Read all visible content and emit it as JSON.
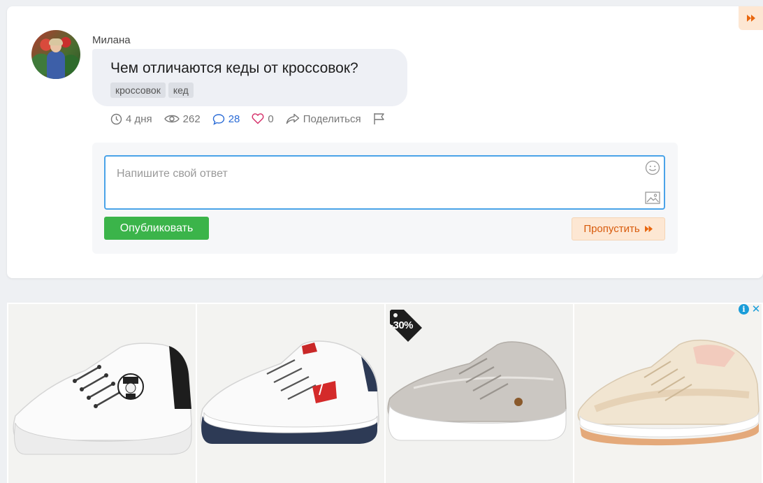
{
  "question_card": {
    "author": "Милана",
    "question": "Чем отличаются кеды от кроссовок?",
    "tags": [
      "кроссовок",
      "кед"
    ],
    "meta": {
      "age": "4 дня",
      "views": "262",
      "comments": "28",
      "likes": "0",
      "share": "Поделиться"
    }
  },
  "answer_form": {
    "placeholder": "Напишите свой ответ",
    "publish_label": "Опубликовать",
    "skip_label": "Пропустить"
  },
  "ad": {
    "info_glyph": "i",
    "close_glyph": "✕",
    "discount_badge": "-30%",
    "tiles": [
      "white-platform-sneaker",
      "white-levis-sneaker",
      "grey-suede-sneaker",
      "beige-retro-runner"
    ]
  },
  "colors": {
    "accent_green": "#3bb44a",
    "skip_bg": "#fde7d3",
    "skip_text": "#d85b0c",
    "focus_border": "#4aa3e8",
    "comment_blue": "#2a6bd6",
    "heart_pink": "#d6336c"
  }
}
